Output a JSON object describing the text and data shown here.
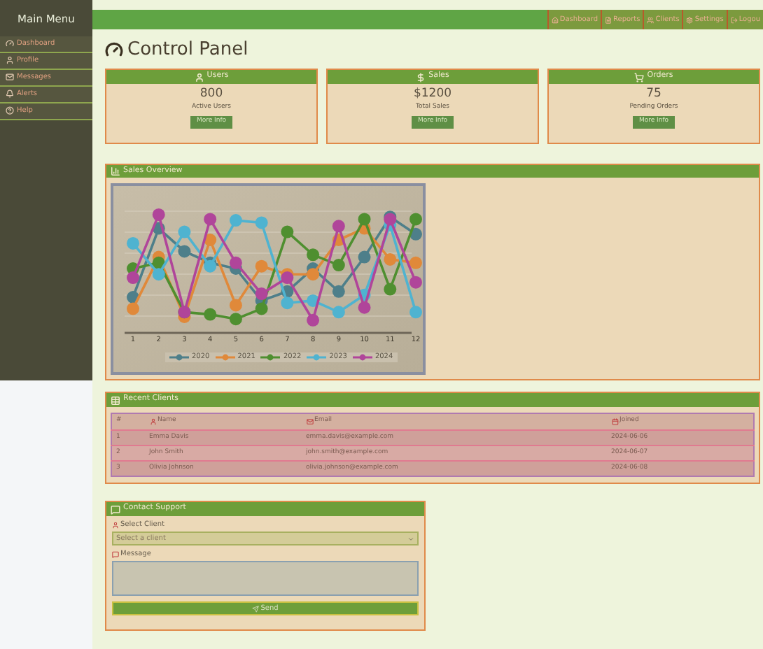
{
  "sidebar": {
    "title": "Main Menu",
    "items": [
      {
        "label": "Dashboard"
      },
      {
        "label": "Profile"
      },
      {
        "label": "Messages"
      },
      {
        "label": "Alerts"
      },
      {
        "label": "Help"
      }
    ]
  },
  "top_nav": [
    {
      "label": "Dashboard"
    },
    {
      "label": "Reports"
    },
    {
      "label": "Clients"
    },
    {
      "label": "Settings"
    },
    {
      "label": "Logou"
    }
  ],
  "page_title": "Control Panel",
  "stats": [
    {
      "title": "Users",
      "value": "800",
      "label": "Active Users",
      "button": "More Info"
    },
    {
      "title": "Sales",
      "value": "$1200",
      "label": "Total Sales",
      "button": "More Info"
    },
    {
      "title": "Orders",
      "value": "75",
      "label": "Pending Orders",
      "button": "More Info"
    }
  ],
  "sales_overview": {
    "title": "Sales Overview",
    "x_labels": [
      "1",
      "2",
      "3",
      "4",
      "5",
      "6",
      "7",
      "8",
      "9",
      "10",
      "11",
      "12"
    ],
    "legend": [
      {
        "name": "2020",
        "color": "#4e7f8a"
      },
      {
        "name": "2021",
        "color": "#e0893a"
      },
      {
        "name": "2022",
        "color": "#4f8f30"
      },
      {
        "name": "2023",
        "color": "#4fb3d0"
      },
      {
        "name": "2024",
        "color": "#b0459a"
      }
    ]
  },
  "recent_clients": {
    "title": "Recent Clients",
    "columns": [
      "#",
      "Name",
      "Email",
      "Joined"
    ],
    "rows": [
      [
        "1",
        "Emma Davis",
        "emma.davis@example.com",
        "2024-06-06"
      ],
      [
        "2",
        "John Smith",
        "john.smith@example.com",
        "2024-06-07"
      ],
      [
        "3",
        "Olivia Johnson",
        "olivia.johnson@example.com",
        "2024-06-08"
      ]
    ]
  },
  "contact_support": {
    "title": "Contact Support",
    "client_label": "Select Client",
    "client_placeholder": "Select a client",
    "message_label": "Message",
    "button": "Send"
  }
}
